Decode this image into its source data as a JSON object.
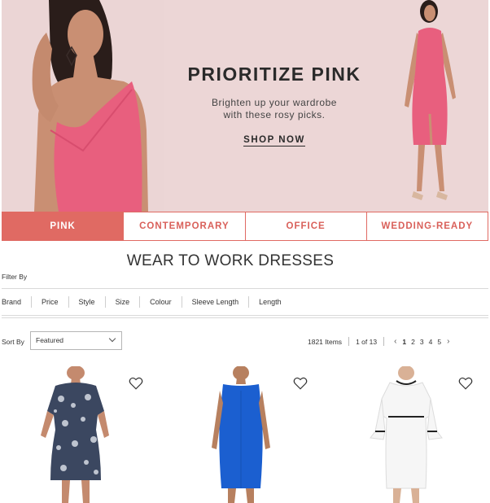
{
  "banner": {
    "title": "PRIORITIZE PINK",
    "subtitle_line1": "Brighten up your wardrobe",
    "subtitle_line2": "with these rosy picks.",
    "cta": "SHOP NOW"
  },
  "category_tabs": [
    {
      "label": "PINK",
      "active": true
    },
    {
      "label": "CONTEMPORARY",
      "active": false
    },
    {
      "label": "OFFICE",
      "active": false
    },
    {
      "label": "WEDDING-READY",
      "active": false
    }
  ],
  "page_title": "WEAR TO WORK DRESSES",
  "filter_by_label": "Filter By",
  "filters": [
    "Brand",
    "Price",
    "Style",
    "Size",
    "Colour",
    "Sleeve Length",
    "Length"
  ],
  "sort": {
    "label": "Sort By",
    "value": "Featured"
  },
  "results": {
    "count": "1821 Items",
    "page_of": "1 of 13"
  },
  "pagination": {
    "prev": "‹",
    "next": "›",
    "pages": [
      "1",
      "2",
      "3",
      "4",
      "5"
    ],
    "current": "1"
  },
  "products": [
    {
      "name": "floral-print-dress",
      "color": "#2f3a52"
    },
    {
      "name": "blue-sheath-dress",
      "color": "#1b5fd0"
    },
    {
      "name": "white-bell-sleeve-dress",
      "color": "#f4f4f4"
    }
  ],
  "icons": {
    "favorite": "heart-icon",
    "dropdown": "chevron-down-icon"
  },
  "colors": {
    "accent": "#e06a63",
    "banner_bg": "#ecd6d6",
    "dress_pink": "#e85f7e"
  }
}
